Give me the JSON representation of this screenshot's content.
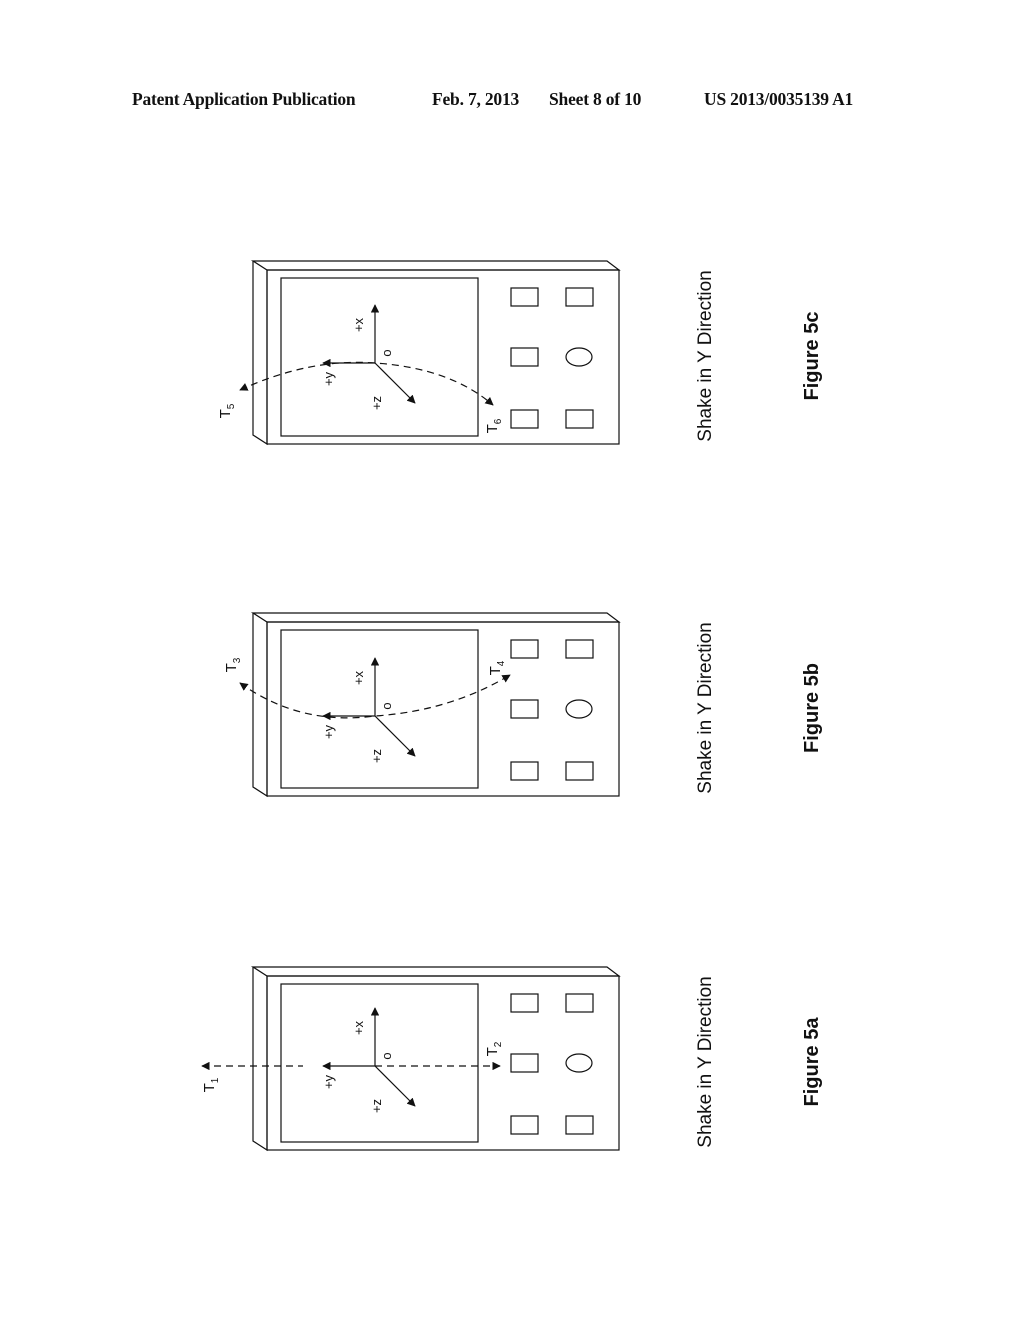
{
  "header": {
    "publication": "Patent Application Publication",
    "date": "Feb. 7, 2013",
    "sheet": "Sheet 8 of 10",
    "number": "US 2013/0035139 A1"
  },
  "figures": [
    {
      "id": "5c",
      "label": "Figure 5c",
      "caption": "Shake in Y Direction",
      "motion": "arc",
      "t_start": "T",
      "t_start_sub": "5",
      "t_end": "T",
      "t_end_sub": "6",
      "axes": {
        "x": "+x",
        "y": "+y",
        "z": "+z",
        "origin": "o"
      }
    },
    {
      "id": "5b",
      "label": "Figure 5b",
      "caption": "Shake in Y Direction",
      "motion": "arc",
      "t_start": "T",
      "t_start_sub": "3",
      "t_end": "T",
      "t_end_sub": "4",
      "axes": {
        "x": "+x",
        "y": "+y",
        "z": "+z",
        "origin": "o"
      }
    },
    {
      "id": "5a",
      "label": "Figure 5a",
      "caption": "Shake in Y Direction",
      "motion": "linear",
      "t_start": "T",
      "t_start_sub": "1",
      "t_end": "T",
      "t_end_sub": "2",
      "axes": {
        "x": "+x",
        "y": "+y",
        "z": "+z",
        "origin": "o"
      }
    }
  ]
}
